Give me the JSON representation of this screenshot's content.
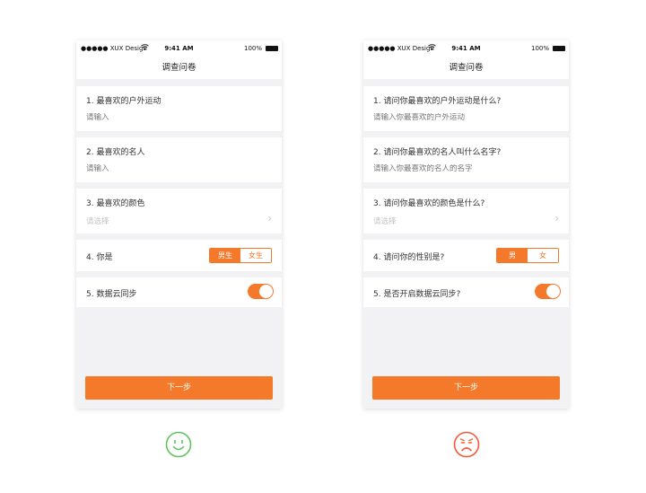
{
  "status_bar": {
    "carrier": "●●●●● XUX Design",
    "wifi_icon": "wifi-icon",
    "time": "9:41 AM",
    "battery": "100%"
  },
  "colors": {
    "accent": "#f4792b",
    "happy": "#5cc55c",
    "sad": "#f25a3c"
  },
  "left_screen": {
    "title": "调查问卷",
    "q1": {
      "label": "1. 最喜欢的户外运动",
      "placeholder": "请输入"
    },
    "q2": {
      "label": "2. 最喜欢的名人",
      "placeholder": "请输入"
    },
    "q3": {
      "label": "3. 最喜欢的颜色",
      "placeholder": "请选择"
    },
    "q4": {
      "label": "4. 你是",
      "option_selected": "男生",
      "option_other": "女生"
    },
    "q5": {
      "label": "5. 数据云同步",
      "toggle_on": true
    },
    "next_label": "下一步",
    "verdict_icon": "smile-icon"
  },
  "right_screen": {
    "title": "调查问卷",
    "q1": {
      "label": "1. 请问你最喜欢的户外运动是什么?",
      "placeholder": "请输入你最喜欢的户外运动"
    },
    "q2": {
      "label": "2. 请问你最喜欢的名人叫什么名字?",
      "placeholder": "请输入你最喜欢的名人的名字"
    },
    "q3": {
      "label": "3. 请问你最喜欢的颜色是什么?",
      "placeholder": "请选择"
    },
    "q4": {
      "label": "4. 请问你的性别是?",
      "option_selected": "男",
      "option_other": "女"
    },
    "q5": {
      "label": "5. 是否开启数据云同步?",
      "toggle_on": true
    },
    "next_label": "下一步",
    "verdict_icon": "frown-icon"
  }
}
